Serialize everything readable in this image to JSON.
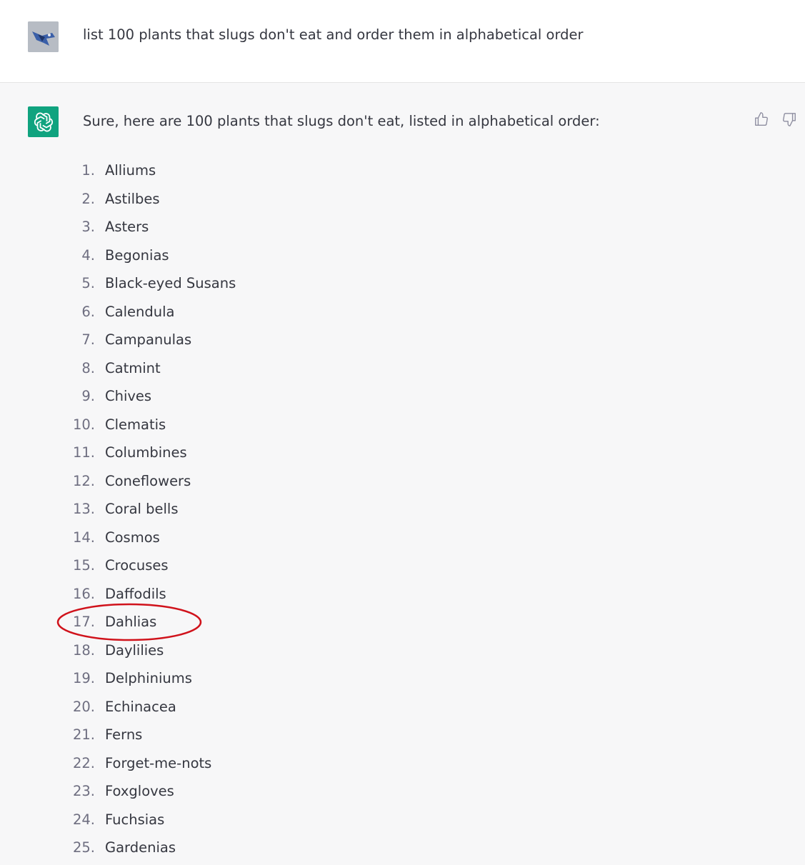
{
  "user": {
    "avatar_icon": "user-avatar-image",
    "prompt": "list 100 plants that slugs don't eat and order them in alphabetical order"
  },
  "assistant": {
    "logo_icon": "openai-logo-icon",
    "brand_color": "#10a37f",
    "intro": "Sure, here are 100 plants that slugs don't eat, listed in alphabetical order:",
    "feedback": {
      "thumbs_up_icon": "thumbs-up-icon",
      "thumbs_down_icon": "thumbs-down-icon"
    },
    "plants": [
      {
        "num": "1.",
        "name": "Alliums"
      },
      {
        "num": "2.",
        "name": "Astilbes"
      },
      {
        "num": "3.",
        "name": "Asters"
      },
      {
        "num": "4.",
        "name": "Begonias"
      },
      {
        "num": "5.",
        "name": "Black-eyed Susans"
      },
      {
        "num": "6.",
        "name": "Calendula"
      },
      {
        "num": "7.",
        "name": "Campanulas"
      },
      {
        "num": "8.",
        "name": "Catmint"
      },
      {
        "num": "9.",
        "name": "Chives"
      },
      {
        "num": "10.",
        "name": "Clematis"
      },
      {
        "num": "11.",
        "name": "Columbines"
      },
      {
        "num": "12.",
        "name": "Coneflowers"
      },
      {
        "num": "13.",
        "name": "Coral bells"
      },
      {
        "num": "14.",
        "name": "Cosmos"
      },
      {
        "num": "15.",
        "name": "Crocuses"
      },
      {
        "num": "16.",
        "name": "Daffodils"
      },
      {
        "num": "17.",
        "name": "Dahlias"
      },
      {
        "num": "18.",
        "name": "Daylilies"
      },
      {
        "num": "19.",
        "name": "Delphiniums"
      },
      {
        "num": "20.",
        "name": "Echinacea"
      },
      {
        "num": "21.",
        "name": "Ferns"
      },
      {
        "num": "22.",
        "name": "Forget-me-nots"
      },
      {
        "num": "23.",
        "name": "Foxgloves"
      },
      {
        "num": "24.",
        "name": "Fuchsias"
      },
      {
        "num": "25.",
        "name": "Gardenias"
      }
    ]
  },
  "annotation": {
    "highlight_color": "#d0121b"
  }
}
